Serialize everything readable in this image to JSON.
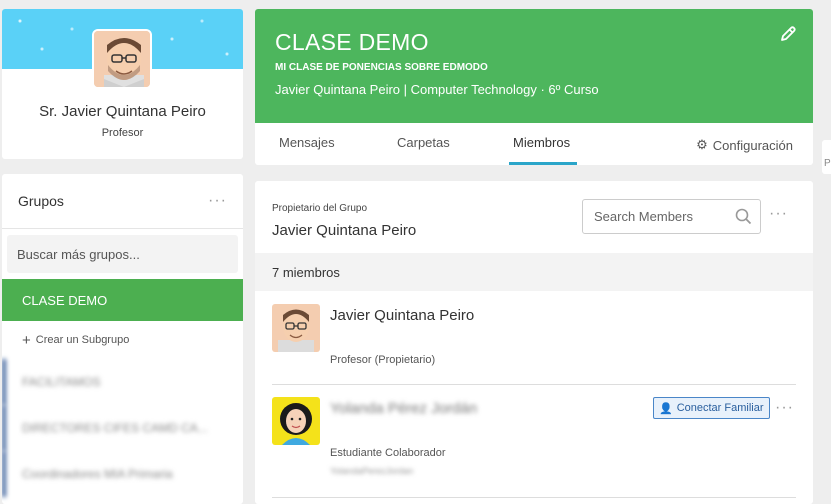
{
  "profile": {
    "name": "Sr. Javier Quintana Peiro",
    "role": "Profesor"
  },
  "groups": {
    "title": "Grupos",
    "more": "···",
    "search_placeholder": "Buscar más grupos...",
    "active_group": "CLASE DEMO",
    "create_subgroup": "Crear un Subgrupo",
    "other_groups": [
      "FACILITAMOS",
      "DIRECTORES CIFES CAMD CA...",
      "Coordinadores MIA Primaria"
    ]
  },
  "class": {
    "title": "CLASE DEMO",
    "subtitle": "MI CLASE DE PONENCIAS SOBRE EDMODO",
    "meta": "Javier Quintana Peiro | Computer Technology  · 6º Curso",
    "tabs": [
      "Mensajes",
      "Carpetas",
      "Miembros"
    ],
    "active_tab": "Miembros",
    "config_label": "Configuración"
  },
  "members": {
    "owner_label": "Propietario del Grupo",
    "owner_name": "Javier Quintana Peiro",
    "search_placeholder": "Search Members",
    "more": "···",
    "count_label": "7 miembros",
    "list": [
      {
        "name": "Javier Quintana Peiro",
        "role": "Profesor (Propietario)"
      },
      {
        "name": "Yolanda Pérez Jordán",
        "role": "Estudiante Colaborador",
        "username": "YolandaPerezJordan",
        "connect_label": "Conectar Familiar"
      }
    ]
  },
  "edge_tab": "P",
  "colors": {
    "green": "#4db65d",
    "active_group": "#4caf50",
    "tab_underline": "#2aa5c9",
    "banner_blue": "#5ad1f7"
  }
}
